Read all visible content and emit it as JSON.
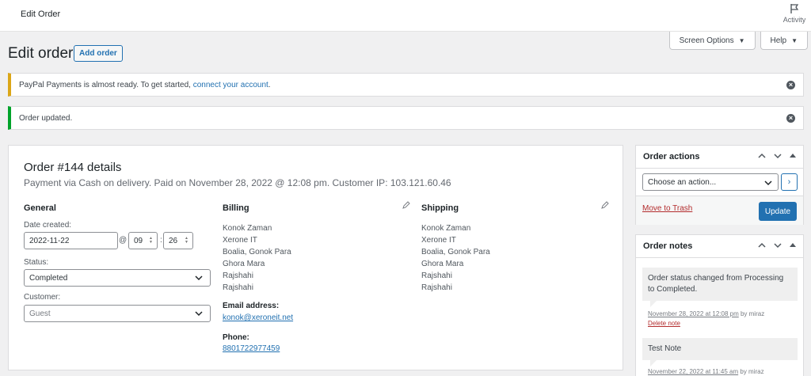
{
  "topbar": {
    "title": "Edit Order",
    "activity_label": "Activity"
  },
  "screen_tabs": {
    "screen_options": "Screen Options",
    "help": "Help",
    "caret": "▼"
  },
  "page": {
    "title": "Edit order",
    "add_order": "Add order"
  },
  "notices": {
    "paypal_text": "PayPal Payments is almost ready. To get started,",
    "paypal_link": "connect your account",
    "paypal_end": ".",
    "updated": "Order updated.",
    "dismiss": "×"
  },
  "order": {
    "heading": "Order #144 details",
    "meta": "Payment via Cash on delivery. Paid on November 28, 2022 @ 12:08 pm. Customer IP: 103.121.60.46",
    "general": {
      "title": "General",
      "date_label": "Date created:",
      "date_value": "2022-11-22",
      "at": "@",
      "hour": "09",
      "colon": ":",
      "minute": "26",
      "status_label": "Status:",
      "status_value": "Completed",
      "customer_label": "Customer:",
      "customer_value": "Guest"
    },
    "billing": {
      "title": "Billing",
      "lines": [
        "Konok Zaman",
        "Xerone IT",
        "Boalia, Gonok Para",
        "Ghora Mara",
        "Rajshahi",
        "Rajshahi"
      ],
      "email_label": "Email address:",
      "email": "konok@xeroneit.net",
      "phone_label": "Phone:",
      "phone": "8801722977459"
    },
    "shipping": {
      "title": "Shipping",
      "lines": [
        "Konok Zaman",
        "Xerone IT",
        "Boalia, Gonok Para",
        "Ghora Mara",
        "Rajshahi",
        "Rajshahi"
      ]
    }
  },
  "order_actions": {
    "title": "Order actions",
    "select_value": "Choose an action...",
    "go": "›",
    "trash": "Move to Trash",
    "update": "Update"
  },
  "order_notes": {
    "title": "Order notes",
    "notes": [
      {
        "text": "Order status changed from Processing to Completed.",
        "date": "November 28, 2022 at 12:08 pm",
        "by": " by miraz",
        "delete": "Delete note"
      },
      {
        "text": "Test Note",
        "date": "November 22, 2022 at 11:45 am",
        "by": " by miraz"
      }
    ]
  }
}
